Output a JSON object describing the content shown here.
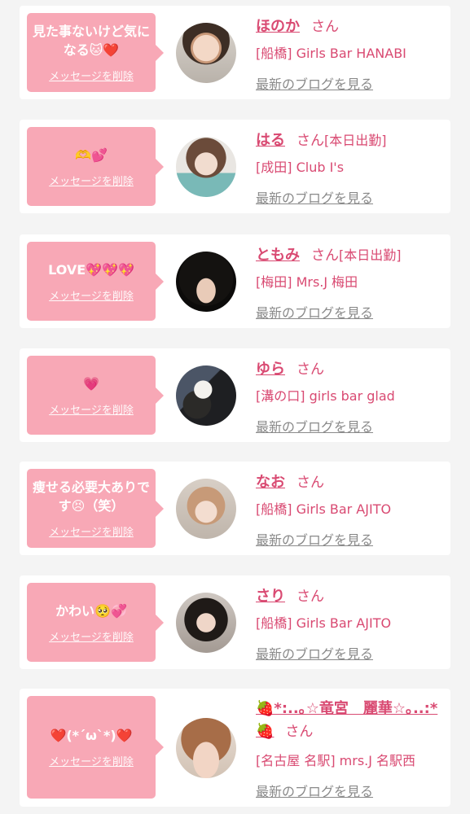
{
  "delete_label": "メッセージを削除",
  "blog_label": "最新のブログを見る",
  "accent_color": "#d94a72",
  "bubble_color": "#f8a8b6",
  "items": [
    {
      "message": "見た事ないけど気になる🐱❤️",
      "name": "ほのか",
      "suffix": "さん",
      "tag": "",
      "shop": "[船橋] Girls Bar HANABI"
    },
    {
      "message": "🫶💕",
      "name": "はる",
      "suffix": "さん",
      "tag": "[本日出勤]",
      "shop": "[成田] Club I's"
    },
    {
      "message": "LOVE💖💖💖",
      "name": "ともみ",
      "suffix": "さん",
      "tag": "[本日出勤]",
      "shop": "[梅田] Mrs.J 梅田"
    },
    {
      "message": "💗",
      "name": "ゆら",
      "suffix": "さん",
      "tag": "",
      "shop": "[溝の口] girls bar glad"
    },
    {
      "message": "痩せる必要大ありです😣（笑）",
      "name": "なお",
      "suffix": "さん",
      "tag": "",
      "shop": "[船橋] Girls Bar AJITO"
    },
    {
      "message": "かわい🥺💞",
      "name": "さり",
      "suffix": "さん",
      "tag": "",
      "shop": "[船橋] Girls Bar AJITO"
    },
    {
      "message": "❤️(*´ω`*)❤️",
      "name": "🍓*:..｡☆竜宮　麗華☆｡..:*🍓",
      "suffix": "さん",
      "tag": "",
      "shop": "[名古屋 名駅] mrs.J 名駅西"
    }
  ]
}
